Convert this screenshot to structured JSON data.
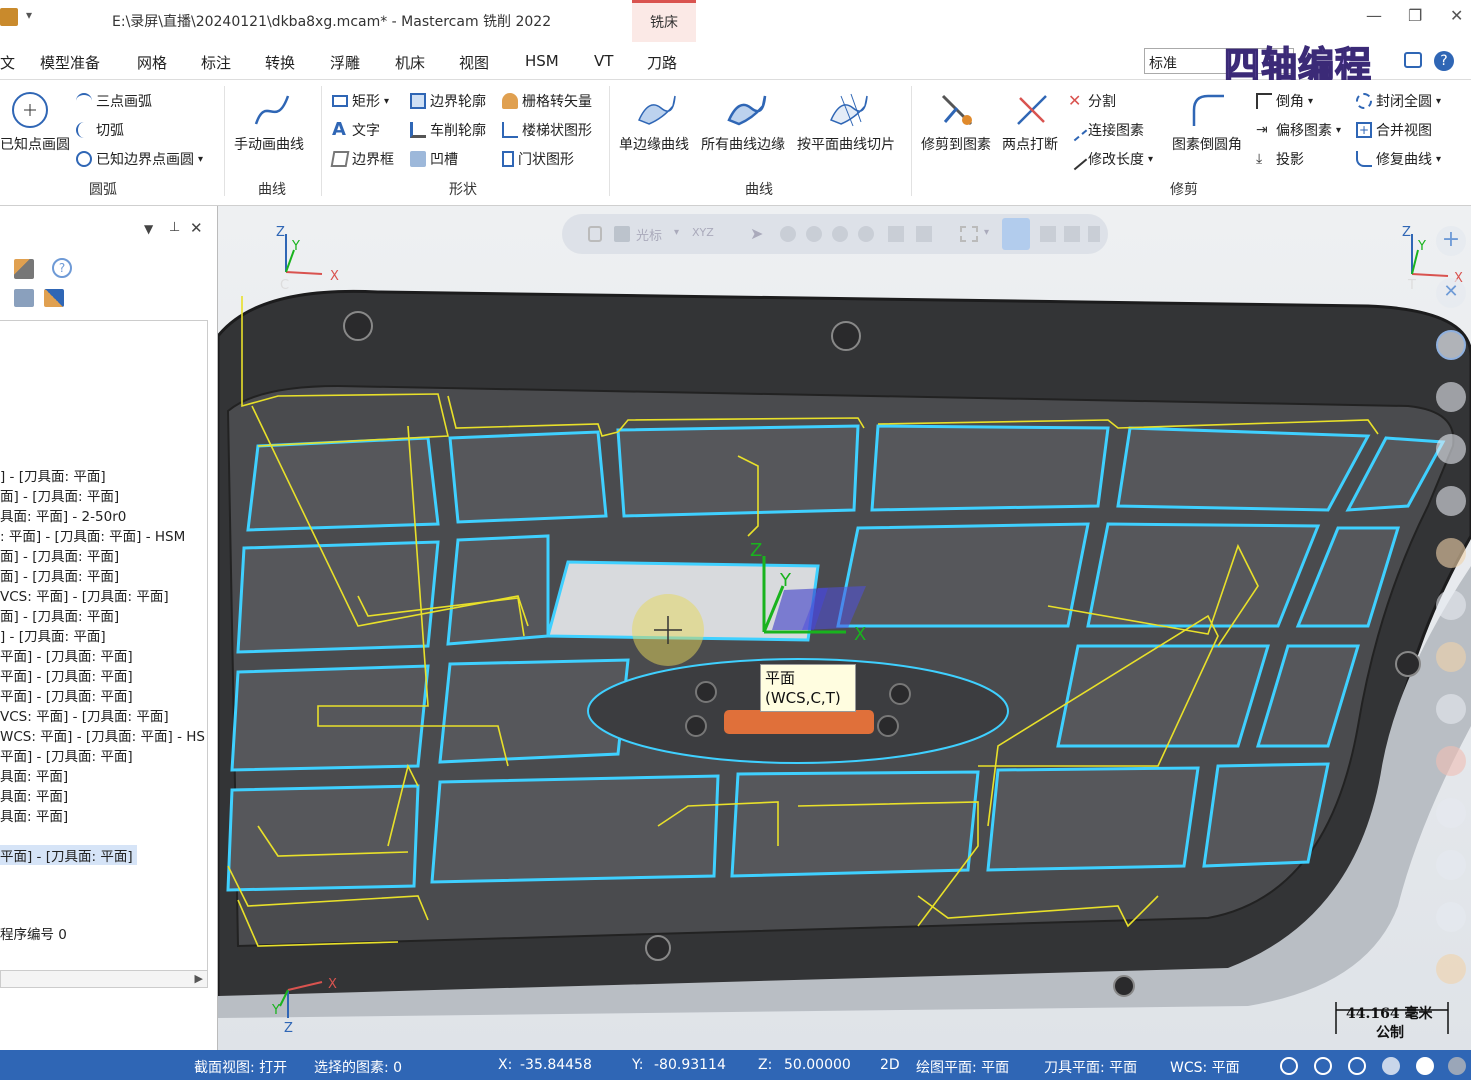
{
  "title": {
    "path": "E:\\录屏\\直播\\20240121\\dkba8xg.mcam* - Mastercam 铣削 2022",
    "context_tab": "铣床"
  },
  "menu": [
    "文",
    "模型准备",
    "网格",
    "标注",
    "转换",
    "浮雕",
    "机床",
    "视图",
    "HSM",
    "VT",
    "刀路"
  ],
  "menu_right": {
    "search_value": "标准",
    "overlay": "四轴编程"
  },
  "ribbon": {
    "arc": {
      "group": "圆弧",
      "big": "已知点画圆",
      "items": [
        "三点画弧",
        "切弧",
        "已知边界点画圆"
      ]
    },
    "curve1": {
      "group": "曲线",
      "big": "手动画曲线"
    },
    "shape": {
      "group": "形状",
      "items": [
        "矩形",
        "文字",
        "边界框",
        "边界轮廓",
        "车削轮廓",
        "凹槽",
        "栅格转矢量",
        "楼梯状图形",
        "门状图形"
      ]
    },
    "curve2": {
      "group": "曲线",
      "items": [
        "单边缘曲线",
        "所有曲线边缘",
        "按平面曲线切片"
      ]
    },
    "trim": {
      "group": "修剪",
      "items": [
        "修剪到图素",
        "两点打断",
        "分割",
        "连接图素",
        "修改长度",
        "图素倒圆角",
        "倒角",
        "偏移图素",
        "投影",
        "封闭全圆",
        "合并视图",
        "修复曲线"
      ]
    }
  },
  "panel": {
    "lines": [
      "] - [刀具面: 平面]",
      "面] - [刀具面: 平面]",
      "具面: 平面] - 2-50r0",
      ": 平面] - [刀具面: 平面] - HSM",
      "面] - [刀具面: 平面]",
      "面] - [刀具面: 平面]",
      "VCS: 平面] - [刀具面: 平面]",
      "面] - [刀具面: 平面]",
      "] - [刀具面: 平面]",
      "平面] - [刀具面: 平面]",
      "平面] - [刀具面: 平面]",
      "平面] - [刀具面: 平面]",
      "VCS: 平面] - [刀具面: 平面]",
      "WCS: 平面] - [刀具面: 平面] - HS",
      "平面] - [刀具面: 平面]",
      "具面: 平面]",
      "具面: 平面]",
      "具面: 平面]"
    ],
    "selected": "平面] - [刀具面: 平面]",
    "program": "程序编号 0"
  },
  "viewport": {
    "toolbar_cursor": "光标",
    "tooltip_line1": "平面",
    "tooltip_line2": "(WCS,C,T)",
    "axis_tl_label": "C",
    "axis_tr_label": "T",
    "scale_value": "44.164 毫米",
    "scale_unit": "公制"
  },
  "status": {
    "section": "截面视图: 打开",
    "selected": "选择的图素: 0",
    "x_label": "X:",
    "x": "-35.84458",
    "y_label": "Y:",
    "y": "-80.93114",
    "z_label": "Z:",
    "z": "50.00000",
    "mode": "2D",
    "cplane": "绘图平面: 平面",
    "tplane": "刀具平面: 平面",
    "wcs": "WCS: 平面"
  },
  "colors": {
    "accent": "#2f66b5",
    "toolpath_yellow": "#e8e02a",
    "edge_cyan": "#3fd0ff",
    "context_red": "#d9534f"
  }
}
